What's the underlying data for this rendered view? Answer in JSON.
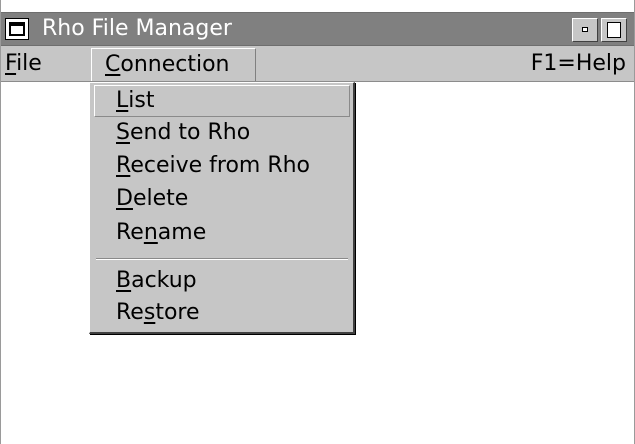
{
  "window": {
    "title": "Rho File Manager"
  },
  "menubar": {
    "file": {
      "pre": "",
      "mnemonic": "F",
      "post": "ile"
    },
    "connection": {
      "pre": "",
      "mnemonic": "C",
      "post": "onnection"
    },
    "help": "F1=Help"
  },
  "dropdown": {
    "items": [
      {
        "pre": "",
        "mnemonic": "L",
        "post": "ist",
        "selected": true
      },
      {
        "pre": "",
        "mnemonic": "S",
        "post": "end to Rho"
      },
      {
        "pre": "",
        "mnemonic": "R",
        "post": "eceive from Rho"
      },
      {
        "pre": "",
        "mnemonic": "D",
        "post": "elete"
      },
      {
        "pre": "Re",
        "mnemonic": "n",
        "post": "ame"
      },
      {
        "pre": "",
        "mnemonic": "B",
        "post": "ackup"
      },
      {
        "pre": "Re",
        "mnemonic": "s",
        "post": "tore"
      }
    ]
  }
}
